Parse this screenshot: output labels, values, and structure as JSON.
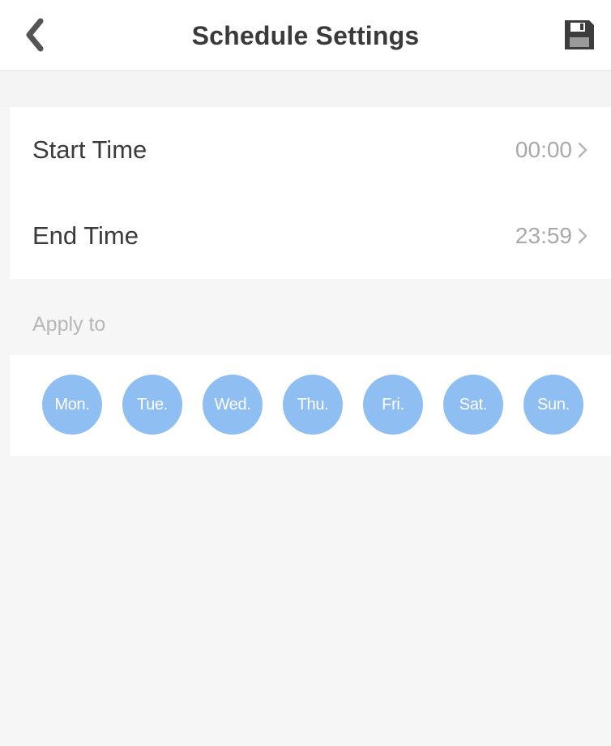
{
  "header": {
    "title": "Schedule Settings",
    "back_icon": "chevron-left-icon",
    "save_icon": "floppy-disk-icon"
  },
  "schedule": {
    "start_time": {
      "label": "Start Time",
      "value": "00:00"
    },
    "end_time": {
      "label": "End Time",
      "value": "23:59"
    }
  },
  "apply": {
    "label": "Apply to",
    "days": [
      "Mon.",
      "Tue.",
      "Wed.",
      "Thu.",
      "Fri.",
      "Sat.",
      "Sun."
    ]
  },
  "colors": {
    "day_circle": "#8fbff2",
    "label_text": "#3b3b3b",
    "value_text": "#a9a9a9",
    "background": "#f6f6f6"
  }
}
